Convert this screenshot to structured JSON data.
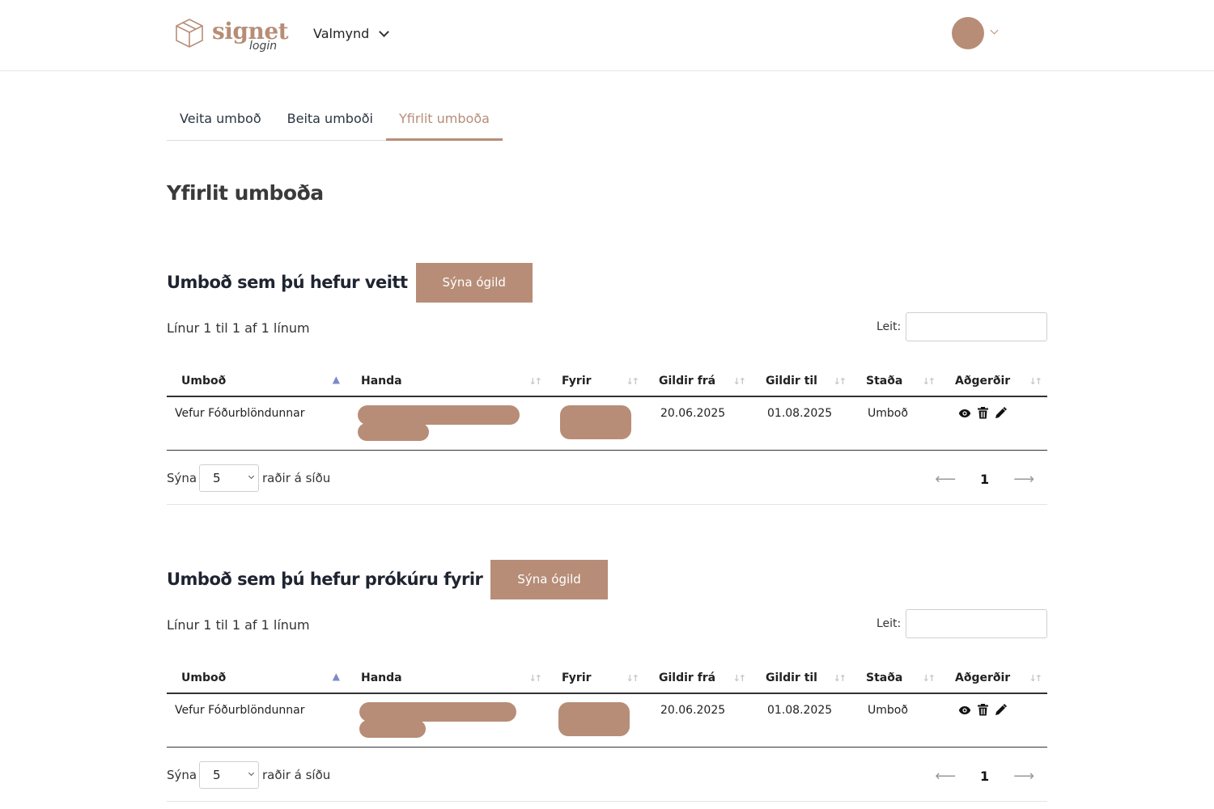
{
  "brand": {
    "name": "signet",
    "sub": "login",
    "color": "#b78d77"
  },
  "header": {
    "menu_label": "Valmynd"
  },
  "tabs": [
    {
      "label": "Veita umboð"
    },
    {
      "label": "Beita umboði"
    },
    {
      "label": "Yfirlit umboða",
      "active": true
    }
  ],
  "page_title": "Yfirlit umboða",
  "sections": [
    {
      "title": "Umboð sem þú hefur veitt",
      "button": "Sýna ógild",
      "info": "Línur 1 til 1 af 1 línum",
      "search_label": "Leit:",
      "columns": [
        "Umboð",
        "Handa",
        "Fyrir",
        "Gildir frá",
        "Gildir til",
        "Staða",
        "Aðgerðir"
      ],
      "rows": [
        {
          "umbod": "Vefur Fóðurblöndunnar",
          "gildir_fra": "20.06.2025",
          "gildir_til": "01.08.2025",
          "stada": "Umboð"
        }
      ],
      "show_label": "Sýna",
      "page_size": "5",
      "rows_label": "raðir á síðu",
      "page": "1"
    },
    {
      "title": "Umboð sem þú hefur prókúru fyrir",
      "button": "Sýna ógild",
      "info": "Línur 1 til 1 af 1 línum",
      "search_label": "Leit:",
      "columns": [
        "Umboð",
        "Handa",
        "Fyrir",
        "Gildir frá",
        "Gildir til",
        "Staða",
        "Aðgerðir"
      ],
      "rows": [
        {
          "umbod": "Vefur Fóðurblöndunnar",
          "gildir_fra": "20.06.2025",
          "gildir_til": "01.08.2025",
          "stada": "Umboð"
        }
      ],
      "show_label": "Sýna",
      "page_size": "5",
      "rows_label": "raðir á síðu",
      "page": "1"
    }
  ],
  "icons": {
    "view": "eye-icon",
    "delete": "trash-icon",
    "edit": "pencil-icon",
    "prev": "arrow-left-icon",
    "next": "arrow-right-icon"
  }
}
